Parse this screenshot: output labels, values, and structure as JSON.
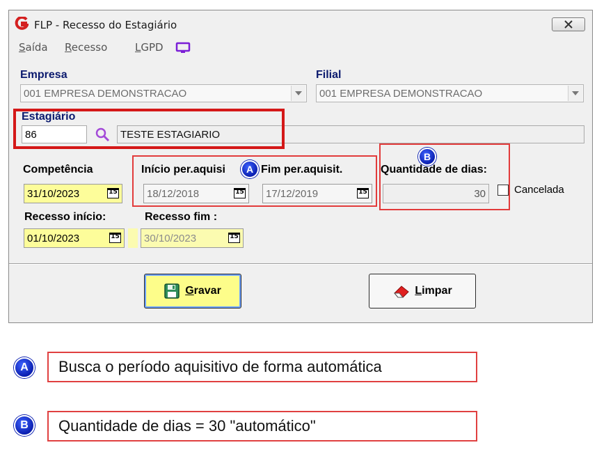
{
  "window": {
    "title": "FLP - Recesso do Estagiário",
    "close_icon": "close-x-icon"
  },
  "menu": {
    "items": [
      {
        "label_first": "S",
        "label_rest": "aída"
      },
      {
        "label_first": "R",
        "label_rest": "ecesso"
      },
      {
        "label_first": "L",
        "label_rest": "GPD"
      }
    ],
    "lgpd_icon": "monitor-icon",
    "lgpd_icon_color": "#7b1fd6"
  },
  "form": {
    "empresa": {
      "label": "Empresa",
      "value": "001 EMPRESA DEMONSTRACAO"
    },
    "filial": {
      "label": "Filial",
      "value": "001 EMPRESA DEMONSTRACAO"
    },
    "estagiario": {
      "label": "Estagiário",
      "code": "86",
      "name": "TESTE ESTAGIARIO"
    },
    "competencia": {
      "label": "Competência",
      "value": "31/10/2023"
    },
    "inicio_per": {
      "label": "Início per.aquisi",
      "value": "18/12/2018"
    },
    "fim_per": {
      "label": "Fim per.aquisit.",
      "value": "17/12/2019"
    },
    "quantidade": {
      "label": "Quantidade de dias:",
      "value": "30"
    },
    "cancelada": {
      "label": "Cancelada",
      "checked": false
    },
    "recesso_inicio": {
      "label": "Recesso  início:",
      "value": "01/10/2023"
    },
    "recesso_fim": {
      "label": "Recesso fim :",
      "value": "30/10/2023"
    },
    "calendar_icon_text": "15"
  },
  "buttons": {
    "gravar": {
      "first": "G",
      "rest": "ravar"
    },
    "limpar": {
      "first": "L",
      "rest": "impar"
    }
  },
  "markers": {
    "a": "A",
    "b": "B"
  },
  "notes": [
    {
      "marker": "A",
      "text": "Busca o período aquisitivo de forma automática"
    },
    {
      "marker": "B",
      "text": "Quantidade de dias = 30 \"automático\""
    }
  ],
  "colors": {
    "highlight_red": "#e23b3b",
    "label_navy": "#0b1a6e",
    "marker_blue": "#0b1fb0",
    "required_yellow": "#fdfd9a"
  }
}
